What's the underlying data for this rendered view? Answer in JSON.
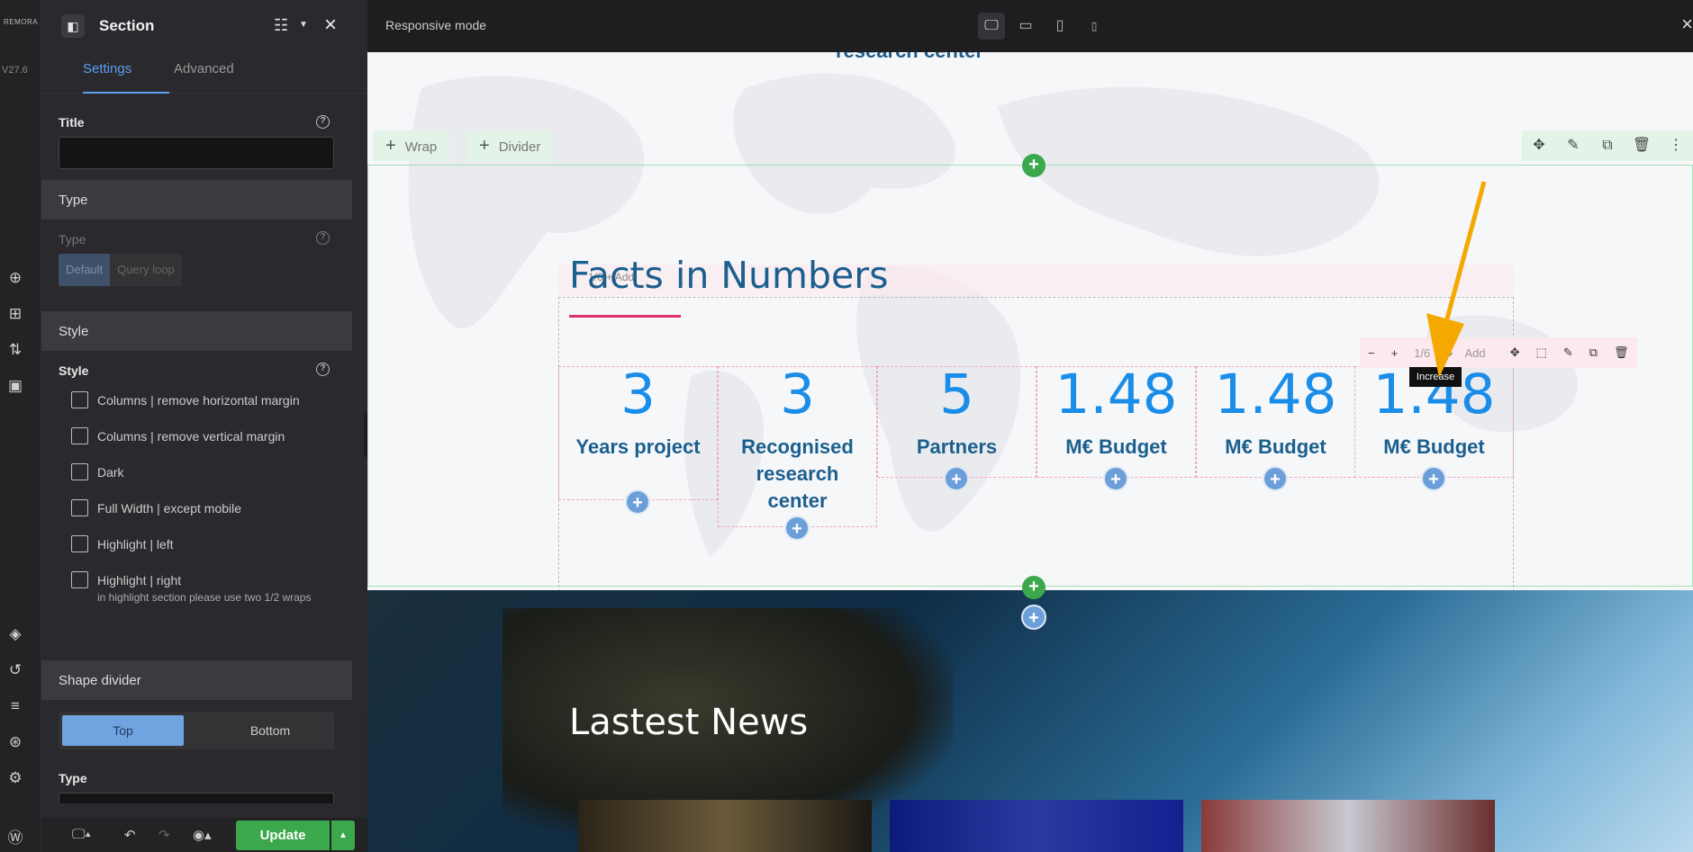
{
  "rail": {
    "logo": "REMORA",
    "version": "V27.6"
  },
  "panel": {
    "title": "Section",
    "tabs": [
      "Settings",
      "Advanced"
    ],
    "title_label": "Title",
    "title_value": "",
    "type_section": "Type",
    "type_label": "Type",
    "type_options": [
      "Default",
      "Query loop"
    ],
    "style_section": "Style",
    "style_label": "Style",
    "style_options": [
      "Columns | remove horizontal margin",
      "Columns | remove vertical margin",
      "Dark",
      "Full Width | except mobile",
      "Highlight | left",
      "Highlight | right"
    ],
    "highlight_note": "in highlight section please use two 1/2 wraps",
    "shape_section": "Shape divider",
    "shape_tabs": [
      "Top",
      "Bottom"
    ],
    "shape_type_label": "Type",
    "update_label": "Update"
  },
  "topbar": {
    "mode": "Responsive mode"
  },
  "canvas": {
    "partial_heading": "research center",
    "wrap_label": "Wrap",
    "divider_label": "Divider",
    "facts_title": "Facts in Numbers",
    "ghost_toolbar": "1/6  + Add",
    "columns": [
      {
        "num": "3",
        "label": "Years project"
      },
      {
        "num": "3",
        "label": "Recognised research center"
      },
      {
        "num": "5",
        "label": "Partners"
      },
      {
        "num": "1.48",
        "label": "M€ Budget"
      },
      {
        "num": "1.48",
        "label": "M€ Budget"
      },
      {
        "num": "1.48",
        "label": "M€ Budget"
      }
    ],
    "col_toolbar": {
      "fraction": "1/6",
      "add": "Add"
    },
    "tooltip": "Increase",
    "news_title": "Lastest News"
  },
  "colors": {
    "accent": "#5b9ff0",
    "update": "#3aa84b",
    "facts": "#1b5f8e",
    "numbers": "#1a8de8",
    "arrow": "#f5a800"
  }
}
